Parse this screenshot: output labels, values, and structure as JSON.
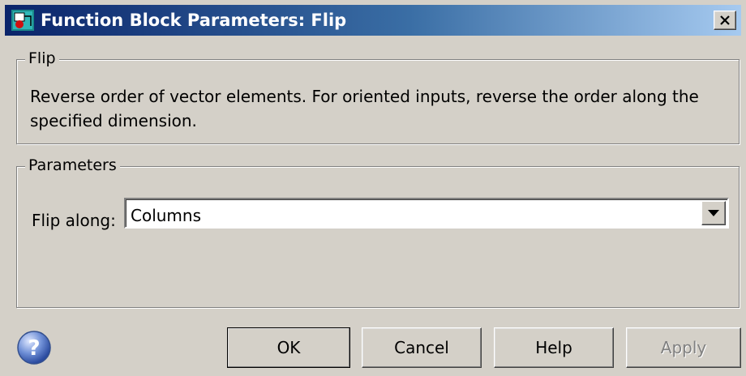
{
  "window": {
    "title": "Function Block Parameters: Flip",
    "close_label": "×"
  },
  "flip_group": {
    "legend": "Flip",
    "description": "Reverse order of vector elements. For oriented inputs, reverse the order along the specified dimension."
  },
  "parameters_group": {
    "legend": "Parameters",
    "flip_along_label": "Flip along:",
    "flip_along_value": "Columns"
  },
  "buttons": {
    "ok": "OK",
    "cancel": "Cancel",
    "help": "Help",
    "apply": "Apply"
  },
  "colors": {
    "titlebar_start": "#0a246a",
    "titlebar_end": "#a6caf0",
    "dialog_bg": "#d4d0c8",
    "disabled_text": "#808080"
  },
  "icons": {
    "title": "simulink-block-icon",
    "close": "close-icon",
    "dropdown": "chevron-down-icon",
    "help": "question-help-icon"
  }
}
